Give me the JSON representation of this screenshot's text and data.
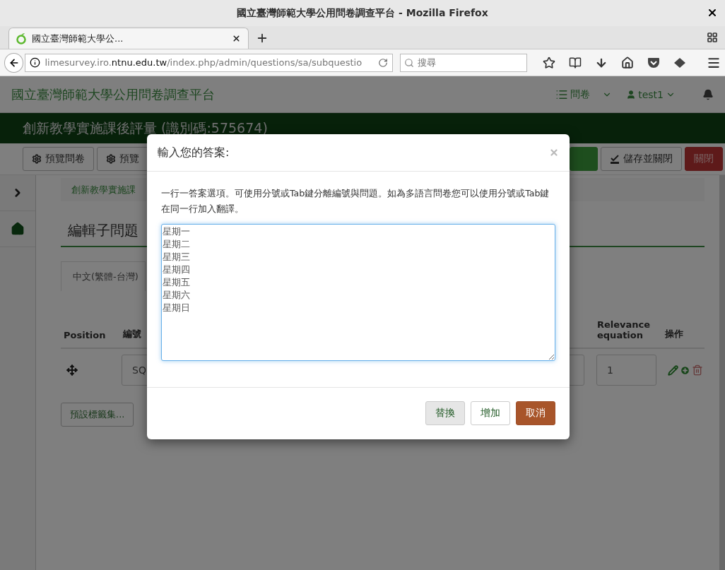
{
  "window": {
    "title": "國立臺灣師範大學公用問卷調查平台 - Mozilla Firefox"
  },
  "tabs": [
    {
      "label": "國立臺灣師範大學公...",
      "selected": true
    }
  ],
  "url": {
    "prefix": "limesurvey.iro.",
    "domain": "ntnu.edu.tw",
    "path": "/index.php/admin/questions/sa/subquestio"
  },
  "search": {
    "placeholder": "搜尋"
  },
  "site": {
    "brand": "國立臺灣師範大學公用問卷調查平台",
    "menu": "問卷",
    "user": "test1"
  },
  "survey": {
    "title": "創新教學實施課後評量 (識別碼:575674)"
  },
  "toolbar": {
    "left": [
      "預覽問卷",
      "預覽"
    ],
    "right": [
      {
        "kind": "primary"
      },
      {
        "kind": "save",
        "label": "儲存並關閉"
      },
      {
        "kind": "close",
        "label": "關閉"
      }
    ]
  },
  "breadcrumb": "創新教學實施課",
  "heading": "編輯子問題",
  "language_tab": {
    "label": "中文(繁體-台灣)",
    "selected": true
  },
  "table": {
    "columns": [
      "Position",
      "編號",
      "Relevance equation",
      "操作"
    ],
    "rows": [
      {
        "code": "SQ",
        "relevance": "1"
      }
    ]
  },
  "bottom_buttons": [
    "預設標籤集..."
  ],
  "modal": {
    "title": "輸入您的答案:",
    "description": "一行一答案選項。可使用分號或Tab鍵分離編號與問題。如為多語言問卷您可以使用分號或Tab鍵在同一行加入翻譯。",
    "lines": [
      "星期一",
      "星期二",
      "星期三",
      "星期四",
      "星期五",
      "星期六",
      "星期日"
    ],
    "buttons": [
      {
        "label": "替換",
        "kind": "default",
        "hovered": true
      },
      {
        "label": "增加",
        "kind": "default",
        "hovered": false
      },
      {
        "label": "取消",
        "kind": "danger",
        "hovered": false
      }
    ]
  }
}
